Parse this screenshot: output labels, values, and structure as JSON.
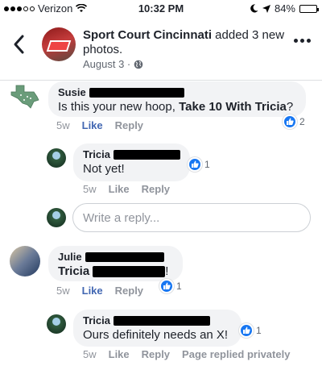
{
  "status_bar": {
    "carrier": "Verizon",
    "time": "10:32 PM",
    "battery": "84%",
    "battery_level": 0.84
  },
  "post_header": {
    "page_name": "Sport Court Cincinnati",
    "action_text": " added 3 new photos.",
    "date": "August 3 ·",
    "icons": {
      "back": "chevron-left-icon",
      "privacy": "globe-icon",
      "more": "more-options-icon"
    }
  },
  "comments": [
    {
      "author": "Susie",
      "text_prefix": "Is this your new hoop, ",
      "tag": "Take 10 With Tricia",
      "text_suffix": "?",
      "age": "5w",
      "like_label": "Like",
      "reply_label": "Reply",
      "like_count": "2",
      "liked": true
    },
    {
      "author": "Tricia",
      "text": "Not yet!",
      "age": "5w",
      "like_label": "Like",
      "reply_label": "Reply",
      "like_count": "1",
      "liked": false
    },
    {
      "author": "Julie",
      "tag": "Tricia",
      "text_suffix": "!",
      "age": "5w",
      "like_label": "Like",
      "reply_label": "Reply",
      "like_count": "1",
      "liked": true
    },
    {
      "author": "Tricia",
      "text": "Ours definitely needs an X!",
      "age": "5w",
      "like_label": "Like",
      "reply_label": "Reply",
      "extra_label": "Page replied privately",
      "like_count": "1",
      "liked": false
    }
  ],
  "reply_box": {
    "placeholder": "Write a reply..."
  },
  "colors": {
    "accent": "#4267b2",
    "like_blue": "#1877f2",
    "bubble": "#f2f3f5",
    "muted": "#90949c"
  }
}
